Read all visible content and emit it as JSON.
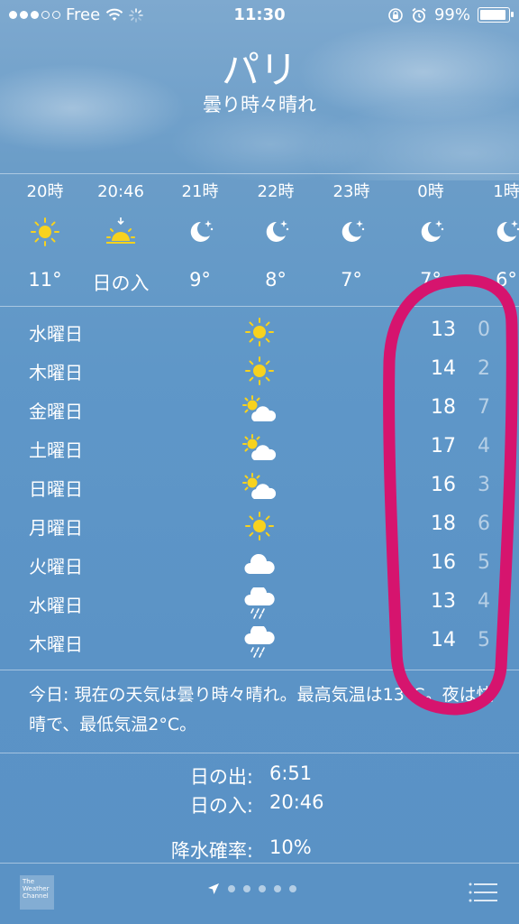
{
  "status": {
    "carrier": "Free",
    "time": "11:30",
    "battery": "99%",
    "battery_level": 0.99
  },
  "header": {
    "city": "パリ",
    "condition": "曇り時々晴れ"
  },
  "hourly": [
    {
      "time": "20時",
      "icon": "sun-icon",
      "temp": "11°"
    },
    {
      "time": "20:46",
      "icon": "sunset-icon",
      "temp": "日の入"
    },
    {
      "time": "21時",
      "icon": "moon-stars-icon",
      "temp": "9°"
    },
    {
      "time": "22時",
      "icon": "moon-stars-icon",
      "temp": "8°"
    },
    {
      "time": "23時",
      "icon": "moon-stars-icon",
      "temp": "7°"
    },
    {
      "time": "0時",
      "icon": "moon-stars-icon",
      "temp": "7°"
    },
    {
      "time": "1時",
      "icon": "moon-stars-icon",
      "temp": "6°"
    }
  ],
  "daily": [
    {
      "day": "水曜日",
      "icon": "sun-icon",
      "high": "13",
      "low": "0"
    },
    {
      "day": "木曜日",
      "icon": "sun-icon",
      "high": "14",
      "low": "2"
    },
    {
      "day": "金曜日",
      "icon": "partly-cloudy-icon",
      "high": "18",
      "low": "7"
    },
    {
      "day": "土曜日",
      "icon": "partly-cloudy-icon",
      "high": "17",
      "low": "4"
    },
    {
      "day": "日曜日",
      "icon": "partly-cloudy-icon",
      "high": "16",
      "low": "3"
    },
    {
      "day": "月曜日",
      "icon": "sun-icon",
      "high": "18",
      "low": "6"
    },
    {
      "day": "火曜日",
      "icon": "cloud-icon",
      "high": "16",
      "low": "5"
    },
    {
      "day": "水曜日",
      "icon": "rain-icon",
      "high": "13",
      "low": "4"
    },
    {
      "day": "木曜日",
      "icon": "rain-icon",
      "high": "14",
      "low": "5"
    }
  ],
  "summary": "今日: 現在の天気は曇り時々晴れ。最高気温は13°C。夜は快晴で、最低気温2°C。",
  "details": [
    {
      "label": "日の出:",
      "value": "6:51"
    },
    {
      "label": "日の入:",
      "value": "20:46"
    },
    {
      "label": "降水確率:",
      "value": "10%"
    }
  ],
  "bottom": {
    "logo_text": "The Weather Channel",
    "page_count": 5
  },
  "colors": {
    "annotation": "#d6146e",
    "sun": "#f7d21e"
  }
}
